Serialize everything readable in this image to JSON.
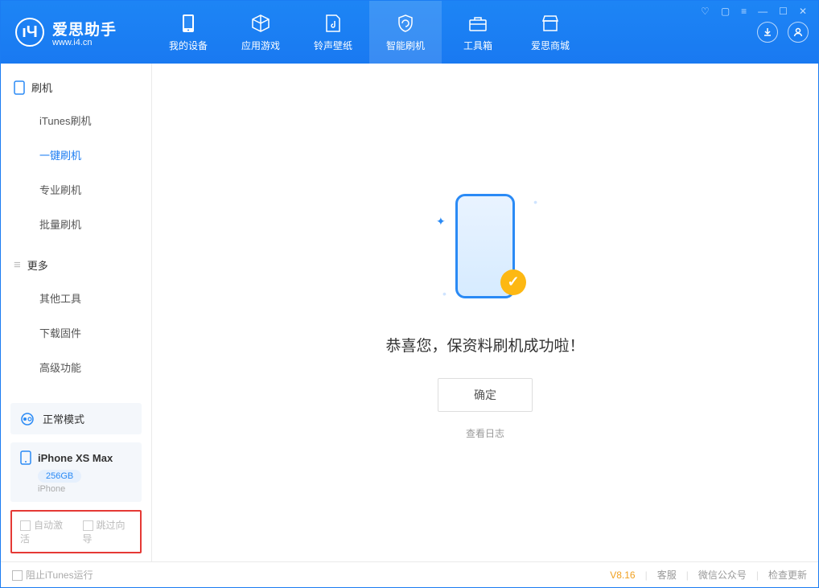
{
  "app": {
    "name_cn": "爱思助手",
    "name_en": "www.i4.cn"
  },
  "tabs": [
    {
      "label": "我的设备"
    },
    {
      "label": "应用游戏"
    },
    {
      "label": "铃声壁纸"
    },
    {
      "label": "智能刷机"
    },
    {
      "label": "工具箱"
    },
    {
      "label": "爱思商城"
    }
  ],
  "sidebar": {
    "section1": {
      "title": "刷机",
      "items": [
        "iTunes刷机",
        "一键刷机",
        "专业刷机",
        "批量刷机"
      ]
    },
    "section2": {
      "title": "更多",
      "items": [
        "其他工具",
        "下载固件",
        "高级功能"
      ]
    },
    "mode": "正常模式",
    "device": {
      "name": "iPhone XS Max",
      "capacity": "256GB",
      "type": "iPhone"
    },
    "opts": {
      "auto_activate": "自动激活",
      "skip_guide": "跳过向导"
    }
  },
  "main": {
    "success": "恭喜您，保资料刷机成功啦！",
    "ok": "确定",
    "view_log": "查看日志"
  },
  "statusbar": {
    "block_itunes": "阻止iTunes运行",
    "version": "V8.16",
    "links": [
      "客服",
      "微信公众号",
      "检查更新"
    ]
  }
}
